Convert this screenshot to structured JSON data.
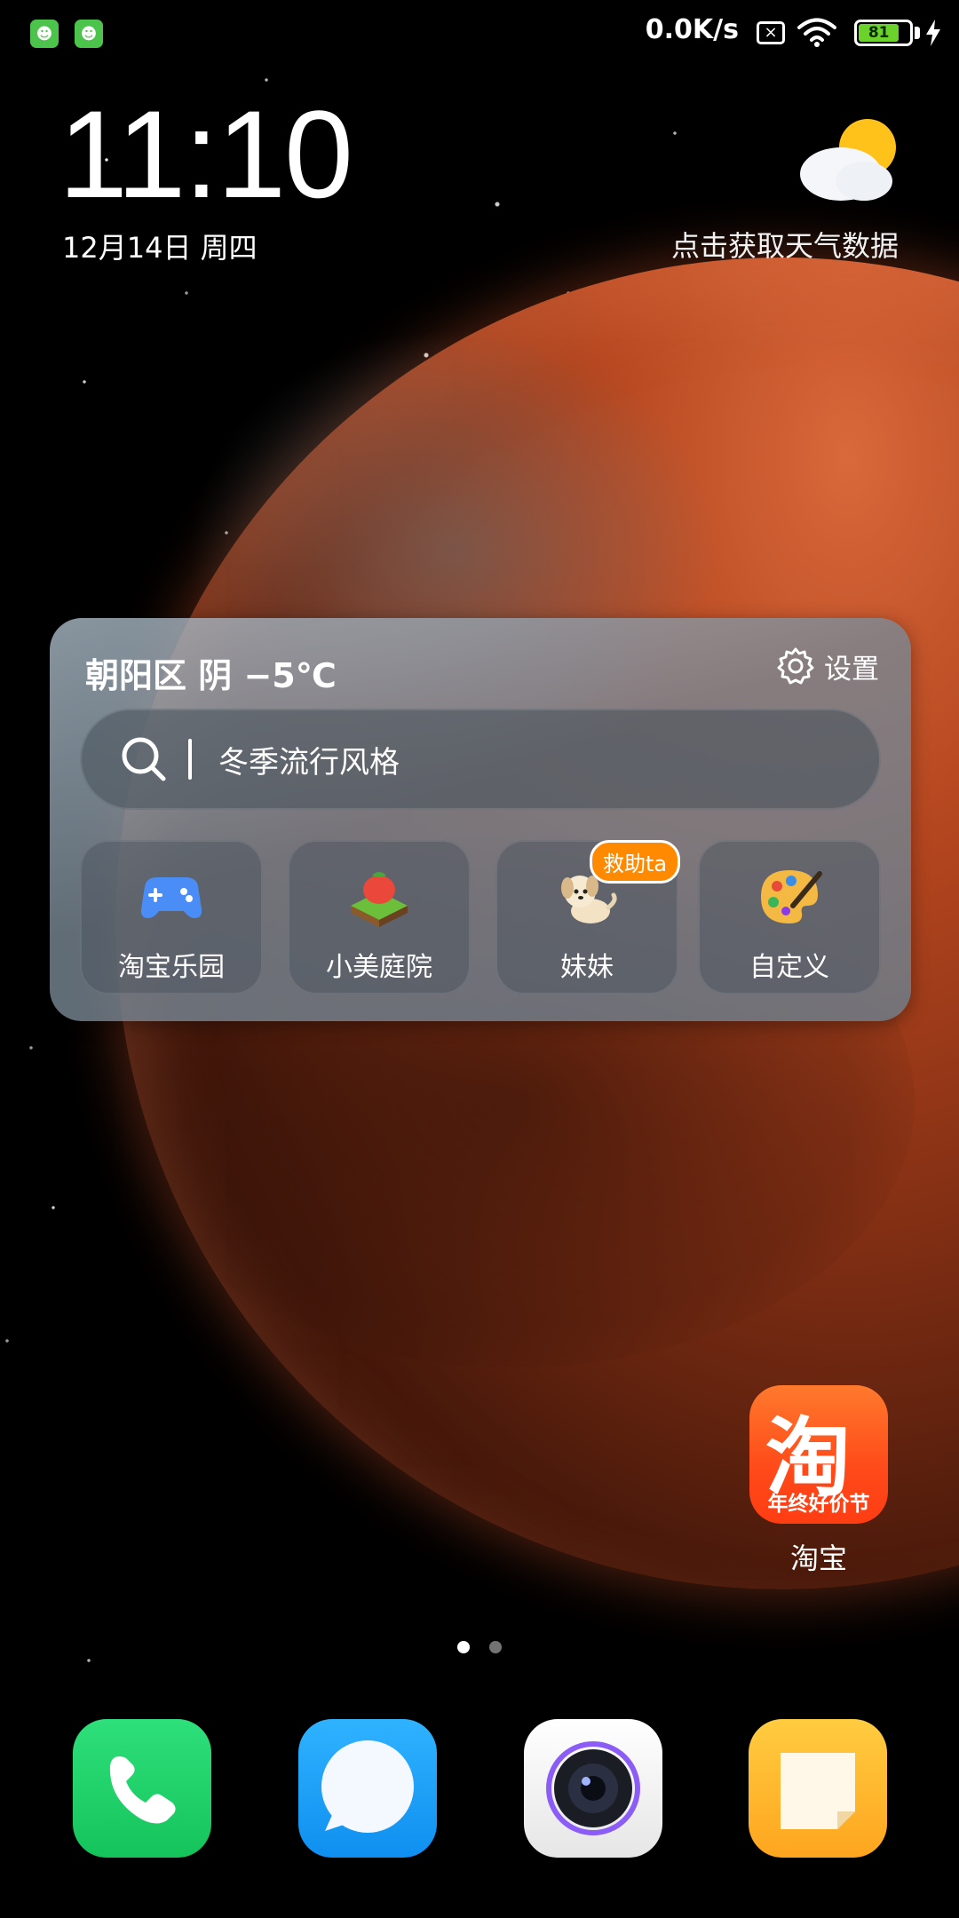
{
  "status_bar": {
    "net_speed": "0.0K/s",
    "battery_level": "81",
    "sim_icon": "sim-none-icon",
    "wifi_icon": "wifi-icon",
    "charge_icon": "charging-bolt-icon"
  },
  "clock": {
    "time": "11:10",
    "date": "12月14日 周四"
  },
  "weather": {
    "icon": "partly-cloudy-icon",
    "prompt": "点击获取天气数据"
  },
  "widget": {
    "weather_line": "朝阳区 阴 −5℃",
    "settings_label": "设置",
    "search_query": "冬季流行风格",
    "shortcuts": [
      {
        "label": "淘宝乐园",
        "icon": "gamepad-icon"
      },
      {
        "label": "小美庭院",
        "icon": "garden-icon"
      },
      {
        "label": "妹妹",
        "icon": "puppy-icon",
        "badge": "救助ta"
      },
      {
        "label": "自定义",
        "icon": "palette-icon"
      }
    ]
  },
  "apps": {
    "taobao": {
      "glyph": "淘",
      "subtitle": "年终好价节",
      "label": "淘宝"
    }
  },
  "page_indicator": {
    "pages": 2,
    "current": 1
  },
  "dock": [
    {
      "name": "phone",
      "icon": "phone-icon"
    },
    {
      "name": "messages",
      "icon": "message-bubble-icon"
    },
    {
      "name": "camera",
      "icon": "camera-icon"
    },
    {
      "name": "notes",
      "icon": "notes-icon"
    }
  ],
  "colors": {
    "battery": "#6bd22c",
    "badge": "#ff8a00",
    "taobao": "#ff4a1a"
  }
}
